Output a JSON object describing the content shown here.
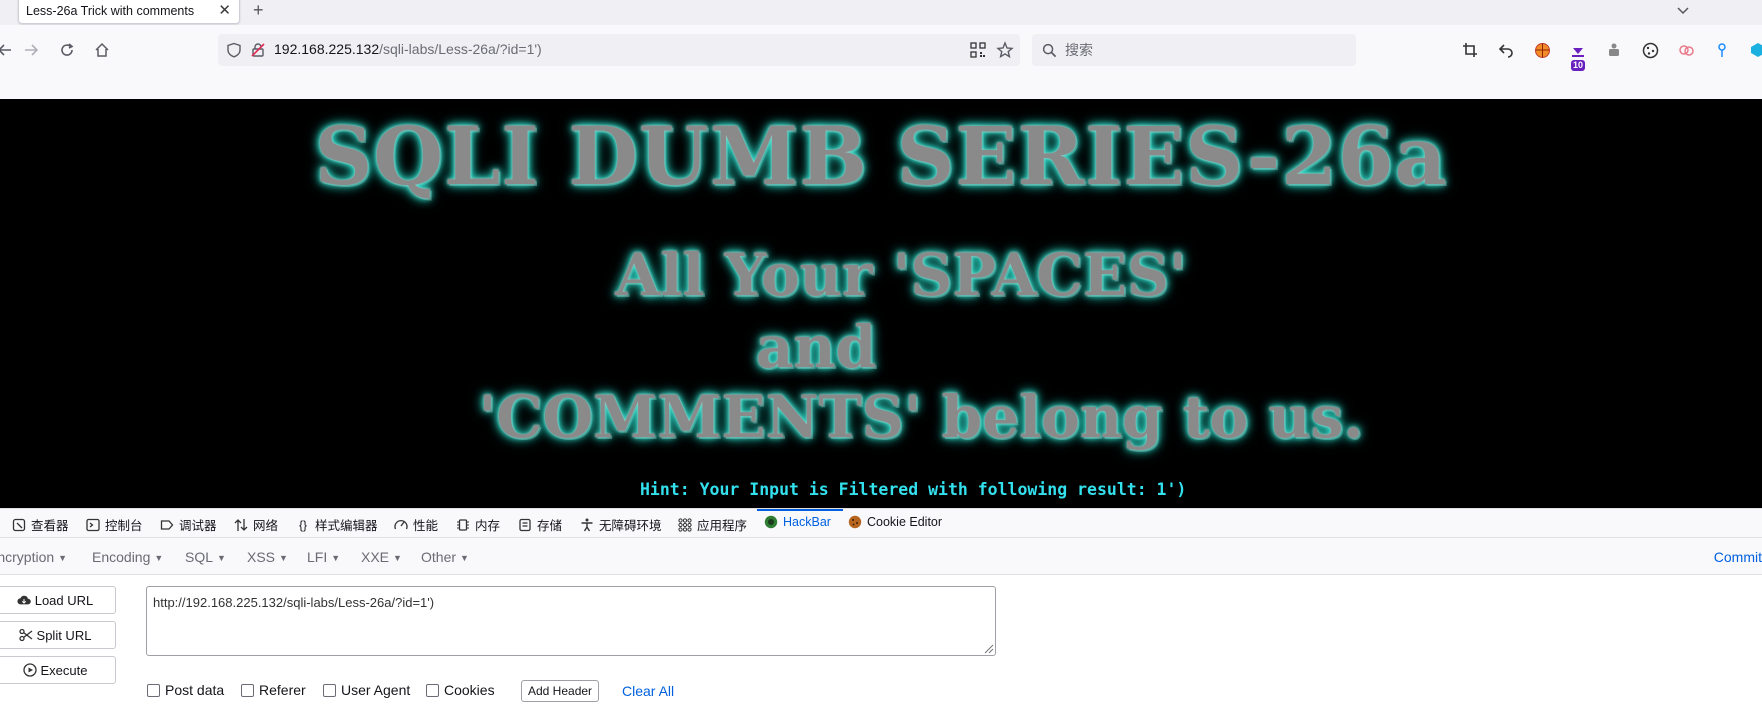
{
  "browser": {
    "tab": {
      "title": "Less-26a Trick with comments",
      "close": "✕"
    },
    "new_tab": "+",
    "url": {
      "host": "192.168.225.132",
      "path": "/sqli-labs/Less-26a/?id=1')"
    },
    "search": {
      "placeholder": "搜索"
    },
    "extension_badge": "10"
  },
  "page": {
    "banner_title": "SQLI DUMB SERIES-26a",
    "banner_line1": "All Your 'SPACES'",
    "banner_line2": "and",
    "banner_line3": "'COMMENTS' belong to us.",
    "hint": "Hint: Your Input is Filtered with following result: 1')"
  },
  "devtools": {
    "tabs": [
      {
        "label": "查看器",
        "icon": "inspector-icon"
      },
      {
        "label": "控制台",
        "icon": "console-icon"
      },
      {
        "label": "调试器",
        "icon": "debugger-icon"
      },
      {
        "label": "网络",
        "icon": "network-icon"
      },
      {
        "label": "样式编辑器",
        "icon": "style-editor-icon"
      },
      {
        "label": "性能",
        "icon": "performance-icon"
      },
      {
        "label": "内存",
        "icon": "memory-icon"
      },
      {
        "label": "存储",
        "icon": "storage-icon"
      },
      {
        "label": "无障碍环境",
        "icon": "accessibility-icon"
      },
      {
        "label": "应用程序",
        "icon": "application-icon"
      },
      {
        "label": "HackBar",
        "icon": "hackbar-icon"
      },
      {
        "label": "Cookie Editor",
        "icon": "cookie-icon"
      }
    ],
    "active_tab": "HackBar"
  },
  "hackbar": {
    "menu": [
      "Encryption",
      "Encoding",
      "SQL",
      "XSS",
      "LFI",
      "XXE",
      "Other"
    ],
    "commit": "Commit",
    "buttons": {
      "load": "Load URL",
      "split": "Split URL",
      "execute": "Execute"
    },
    "url_value": "http://192.168.225.132/sqli-labs/Less-26a/?id=1')",
    "options": [
      "Post data",
      "Referer",
      "User Agent",
      "Cookies"
    ],
    "add_header": "Add Header",
    "clear_all": "Clear All"
  },
  "colors": {
    "accent": "#0060df",
    "hint": "#33e0ee",
    "glow": "#2ad4c2",
    "page_bg": "#000000"
  }
}
